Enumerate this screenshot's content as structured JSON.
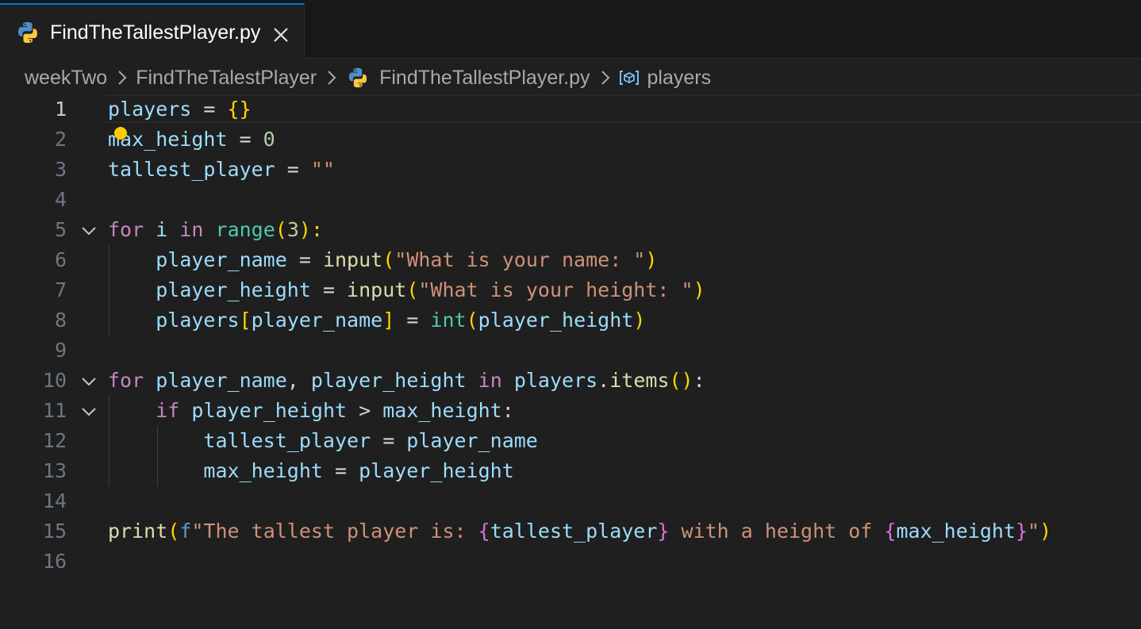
{
  "tab": {
    "title": "FindTheTallestPlayer.py",
    "icon": "python-icon",
    "close_icon": "close-icon"
  },
  "breadcrumb": {
    "items": [
      "weekTwo",
      "FindTheTalestPlayer",
      "FindTheTallestPlayer.py",
      "players"
    ]
  },
  "editor": {
    "active_line": 1,
    "line_numbers": [
      "1",
      "2",
      "3",
      "4",
      "5",
      "6",
      "7",
      "8",
      "9",
      "10",
      "11",
      "12",
      "13",
      "14",
      "15",
      "16"
    ],
    "tokens": {
      "l1": [
        "players",
        " = ",
        "{}"
      ],
      "l2": [
        "max_height",
        " = ",
        "0"
      ],
      "l3": [
        "tallest_player",
        " = ",
        "\"\""
      ],
      "l5": [
        "for",
        " ",
        "i",
        " ",
        "in",
        " ",
        "range",
        "(",
        "3",
        "):"
      ],
      "l6": [
        "    ",
        "player_name",
        " = ",
        "input",
        "(",
        "\"What is your name: \"",
        ")"
      ],
      "l7": [
        "    ",
        "player_height",
        " = ",
        "input",
        "(",
        "\"What is your height: \"",
        ")"
      ],
      "l8": [
        "    ",
        "players",
        "[",
        "player_name",
        "]",
        " = ",
        "int",
        "(",
        "player_height",
        ")"
      ],
      "l10": [
        "for",
        " ",
        "player_name",
        ", ",
        "player_height",
        " ",
        "in",
        " ",
        "players",
        ".",
        "items",
        "()",
        ":"
      ],
      "l11": [
        "    ",
        "if",
        " ",
        "player_height",
        " > ",
        "max_height",
        ":"
      ],
      "l12": [
        "        ",
        "tallest_player",
        " = ",
        "player_name"
      ],
      "l13": [
        "        ",
        "max_height",
        " = ",
        "player_height"
      ],
      "l15": [
        "print",
        "(",
        "f",
        "\"The tallest player is: ",
        "{",
        "tallest_player",
        "}",
        " with a height of ",
        "{",
        "max_height",
        "}",
        "\"",
        ")"
      ]
    }
  },
  "colors": {
    "accent": "#0078d4",
    "background": "#1f1f1f",
    "lightbulb": "#ffcc00"
  }
}
